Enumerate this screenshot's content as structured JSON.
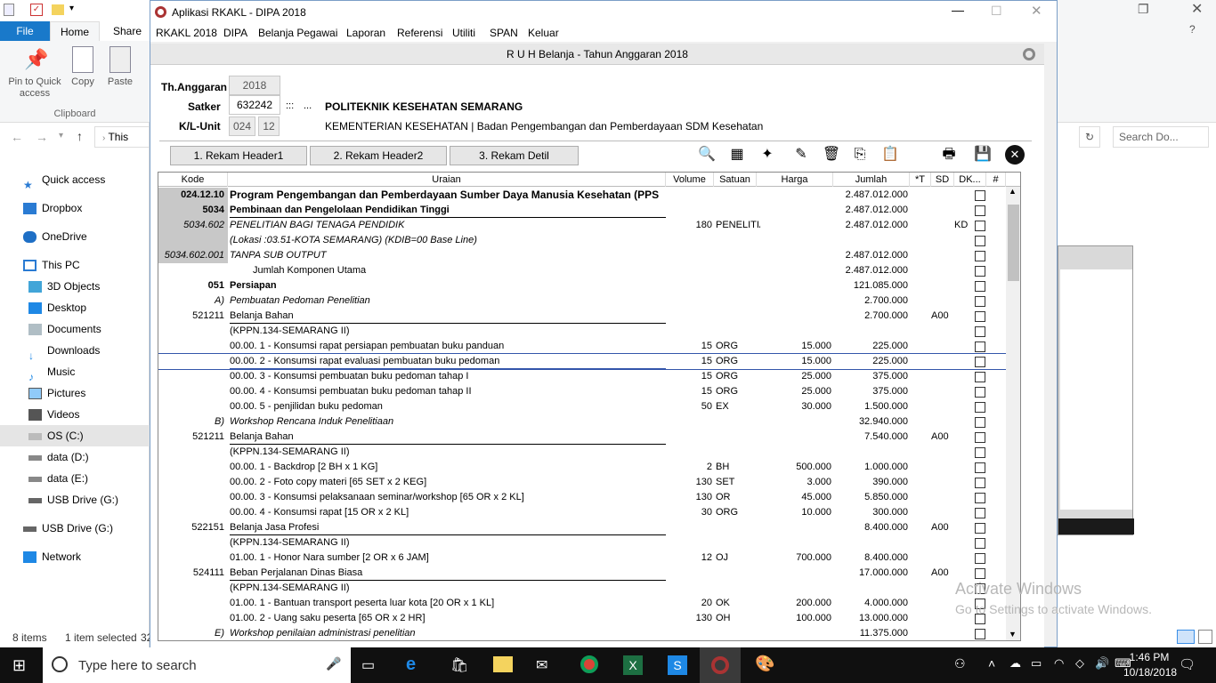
{
  "explorer": {
    "tabs": {
      "file": "File",
      "home": "Home",
      "share": "Share"
    },
    "ribbon": {
      "pin": "Pin to Quick access",
      "copy": "Copy",
      "paste": "Paste",
      "group": "Clipboard"
    },
    "address": "This",
    "nav": [
      {
        "label": "Quick access",
        "icon": "star-icon"
      },
      {
        "label": "Dropbox",
        "icon": "dropbox-icon"
      },
      {
        "label": "OneDrive",
        "icon": "cloud-icon"
      },
      {
        "label": "This PC",
        "icon": "computer-icon"
      },
      {
        "label": "3D Objects",
        "icon": "cube-icon"
      },
      {
        "label": "Desktop",
        "icon": "desktop-icon"
      },
      {
        "label": "Documents",
        "icon": "documents-icon"
      },
      {
        "label": "Downloads",
        "icon": "download-icon"
      },
      {
        "label": "Music",
        "icon": "music-icon"
      },
      {
        "label": "Pictures",
        "icon": "pictures-icon"
      },
      {
        "label": "Videos",
        "icon": "videos-icon"
      },
      {
        "label": "OS (C:)",
        "icon": "drive-icon"
      },
      {
        "label": "data (D:)",
        "icon": "drive-icon"
      },
      {
        "label": "data (E:)",
        "icon": "drive-icon"
      },
      {
        "label": "USB Drive (G:)",
        "icon": "usb-icon"
      },
      {
        "label": "USB Drive (G:)",
        "icon": "usb-icon"
      },
      {
        "label": "Network",
        "icon": "network-icon"
      }
    ],
    "status": {
      "items": "8 items",
      "selected": "1 item selected",
      "extra": "32"
    },
    "search_placeholder": "Search Do..."
  },
  "app": {
    "title": "Aplikasi RKAKL - DIPA 2018",
    "menu": [
      "RKAKL 2018",
      "DIPA",
      "Belanja Pegawai",
      "Laporan",
      "Referensi",
      "Utiliti",
      "SPAN",
      "Keluar"
    ],
    "inner_title": "R U H Belanja  -  Tahun Anggaran 2018",
    "th_label": "Th.Anggaran",
    "th_value": "2018",
    "satker_label": "Satker",
    "satker_value": "632242",
    "satker_sep": ":::",
    "satker_dots": "...",
    "satker_name": "POLITEKNIK KESEHATAN SEMARANG",
    "kl_label": "K/L-Unit",
    "kl_value1": "024",
    "kl_value2": "12",
    "kl_name": "KEMENTERIAN KESEHATAN | Badan Pengembangan dan Pemberdayaan SDM Kesehatan",
    "btn1": "1. Rekam Header1",
    "btn2": "2. Rekam Header2",
    "btn3": "3. Rekam Detil"
  },
  "grid": {
    "headers": [
      "Kode",
      "Uraian",
      "Volume",
      "Satuan",
      "Harga",
      "Jumlah",
      "*T",
      "SD",
      "DK...",
      "#"
    ],
    "rows": [
      {
        "kode": "024.12.10",
        "ur": "Program Pengembangan dan Pemberdayaan Sumber Daya Manusia Kesehatan (PPS",
        "vol": "",
        "sat": "",
        "harga": "",
        "jml": "2.487.012.000",
        "sd": "",
        "dk": "",
        "n": "1"
      },
      {
        "kode": "5034",
        "ur": "Pembinaan dan Pengelolaan Pendidikan Tinggi",
        "vol": "",
        "sat": "",
        "harga": "",
        "jml": "2.487.012.000",
        "sd": "",
        "dk": "",
        "n": "2"
      },
      {
        "kode": "5034.602",
        "ur": "PENELITIAN BAGI TENAGA PENDIDIK",
        "vol": "180",
        "sat": "PENELITIA",
        "harga": "",
        "jml": "2.487.012.000",
        "sd": "",
        "dk": "KD",
        "n": "3"
      },
      {
        "kode": "",
        "ur": "(Lokasi :03.51-KOTA SEMARANG) (KDIB=00 Base Line)",
        "vol": "",
        "sat": "",
        "harga": "",
        "jml": "",
        "sd": "",
        "dk": "",
        "n": "4"
      },
      {
        "kode": "5034.602.001",
        "ur": "TANPA SUB OUTPUT",
        "vol": "",
        "sat": "",
        "harga": "",
        "jml": "2.487.012.000",
        "sd": "",
        "dk": "",
        "n": "5"
      },
      {
        "kode": "",
        "ur": "Jumlah Komponen Utama",
        "vol": "",
        "sat": "",
        "harga": "",
        "jml": "2.487.012.000",
        "sd": "",
        "dk": "",
        "n": "6"
      },
      {
        "kode": "051",
        "ur": "Persiapan",
        "vol": "",
        "sat": "",
        "harga": "",
        "jml": "121.085.000",
        "sd": "",
        "dk": "",
        "n": "7"
      },
      {
        "kode": "A)",
        "ur": "Pembuatan Pedoman Penelitian",
        "vol": "",
        "sat": "",
        "harga": "",
        "jml": "2.700.000",
        "sd": "",
        "dk": "",
        "n": "8"
      },
      {
        "kode": "521211",
        "ur": "Belanja Bahan",
        "vol": "",
        "sat": "",
        "harga": "",
        "jml": "2.700.000",
        "sd": "A00",
        "dk": "",
        "n": "9"
      },
      {
        "kode": "",
        "ur": "(KPPN.134-SEMARANG II)",
        "vol": "",
        "sat": "",
        "harga": "",
        "jml": "",
        "sd": "",
        "dk": "",
        "n": "10"
      },
      {
        "kode": "",
        "ur": "00.00. 1    - Konsumsi rapat persiapan pembuatan buku panduan",
        "vol": "15",
        "sat": "ORG",
        "harga": "15.000",
        "jml": "225.000",
        "sd": "",
        "dk": "",
        "n": "11"
      },
      {
        "kode": "",
        "ur": "00.00. 2    - Konsumsi rapat evaluasi pembuatan buku pedoman",
        "vol": "15",
        "sat": "ORG",
        "harga": "15.000",
        "jml": "225.000",
        "sd": "",
        "dk": "",
        "n": "12"
      },
      {
        "kode": "",
        "ur": "00.00. 3    - Konsumsi pembuatan buku pedoman tahap I",
        "vol": "15",
        "sat": "ORG",
        "harga": "25.000",
        "jml": "375.000",
        "sd": "",
        "dk": "",
        "n": "13"
      },
      {
        "kode": "",
        "ur": "00.00. 4    - Konsumsi pembuatan buku pedoman tahap II",
        "vol": "15",
        "sat": "ORG",
        "harga": "25.000",
        "jml": "375.000",
        "sd": "",
        "dk": "",
        "n": "14"
      },
      {
        "kode": "",
        "ur": "00.00. 5    - penjilidan buku pedoman",
        "vol": "50",
        "sat": "EX",
        "harga": "30.000",
        "jml": "1.500.000",
        "sd": "",
        "dk": "",
        "n": "15"
      },
      {
        "kode": "B)",
        "ur": "Workshop Rencana Induk Penelitiaan",
        "vol": "",
        "sat": "",
        "harga": "",
        "jml": "32.940.000",
        "sd": "",
        "dk": "",
        "n": "16"
      },
      {
        "kode": "521211",
        "ur": "Belanja Bahan",
        "vol": "",
        "sat": "",
        "harga": "",
        "jml": "7.540.000",
        "sd": "A00",
        "dk": "",
        "n": "17"
      },
      {
        "kode": "",
        "ur": "(KPPN.134-SEMARANG II)",
        "vol": "",
        "sat": "",
        "harga": "",
        "jml": "",
        "sd": "",
        "dk": "",
        "n": "18"
      },
      {
        "kode": "",
        "ur": "00.00. 1    - Backdrop  [2 BH x 1 KG]",
        "vol": "2",
        "sat": "BH",
        "harga": "500.000",
        "jml": "1.000.000",
        "sd": "",
        "dk": "",
        "n": "19"
      },
      {
        "kode": "",
        "ur": "00.00. 2    - Foto copy  materi  [65 SET x 2 KEG]",
        "vol": "130",
        "sat": "SET",
        "harga": "3.000",
        "jml": "390.000",
        "sd": "",
        "dk": "",
        "n": "20"
      },
      {
        "kode": "",
        "ur": "00.00. 3    - Konsumsi pelaksanaan seminar/workshop  [65 OR x 2 KL]",
        "vol": "130",
        "sat": "OR",
        "harga": "45.000",
        "jml": "5.850.000",
        "sd": "",
        "dk": "",
        "n": "21"
      },
      {
        "kode": "",
        "ur": "00.00. 4    - Konsumsi rapat  [15 OR x 2 KL]",
        "vol": "30",
        "sat": "ORG",
        "harga": "10.000",
        "jml": "300.000",
        "sd": "",
        "dk": "",
        "n": "22"
      },
      {
        "kode": "522151",
        "ur": "Belanja Jasa Profesi",
        "vol": "",
        "sat": "",
        "harga": "",
        "jml": "8.400.000",
        "sd": "A00",
        "dk": "",
        "n": "23"
      },
      {
        "kode": "",
        "ur": "(KPPN.134-SEMARANG II)",
        "vol": "",
        "sat": "",
        "harga": "",
        "jml": "",
        "sd": "",
        "dk": "",
        "n": "24"
      },
      {
        "kode": "",
        "ur": "01.00. 1    - Honor Nara sumber  [2 OR x 6 JAM]",
        "vol": "12",
        "sat": "OJ",
        "harga": "700.000",
        "jml": "8.400.000",
        "sd": "",
        "dk": "",
        "n": "25"
      },
      {
        "kode": "524111",
        "ur": "Beban Perjalanan Dinas Biasa",
        "vol": "",
        "sat": "",
        "harga": "",
        "jml": "17.000.000",
        "sd": "A00",
        "dk": "",
        "n": "26"
      },
      {
        "kode": "",
        "ur": "(KPPN.134-SEMARANG II)",
        "vol": "",
        "sat": "",
        "harga": "",
        "jml": "",
        "sd": "",
        "dk": "",
        "n": "27"
      },
      {
        "kode": "",
        "ur": "01.00. 1    - Bantuan transport peserta luar kota  [20 OR x 1 KL]",
        "vol": "20",
        "sat": "OK",
        "harga": "200.000",
        "jml": "4.000.000",
        "sd": "",
        "dk": "",
        "n": "28"
      },
      {
        "kode": "",
        "ur": "01.00. 2    - Uang saku peserta  [65 OR x 2 HR]",
        "vol": "130",
        "sat": "OH",
        "harga": "100.000",
        "jml": "13.000.000",
        "sd": "",
        "dk": "",
        "n": "29"
      },
      {
        "kode": "E)",
        "ur": "Workshop penilaian administrasi penelitian",
        "vol": "",
        "sat": "",
        "harga": "",
        "jml": "11.375.000",
        "sd": "",
        "dk": "",
        "n": "30"
      }
    ]
  },
  "watermark": {
    "line1": "Activate Windows",
    "line2": "Go to Settings to activate Windows."
  },
  "taskbar": {
    "search_placeholder": "Type here to search",
    "time": "1:46 PM",
    "date": "10/18/2018"
  },
  "colors": {
    "file_tab": "#1979ca",
    "taskbar": "#101010",
    "shade": "#c8c8c8"
  }
}
